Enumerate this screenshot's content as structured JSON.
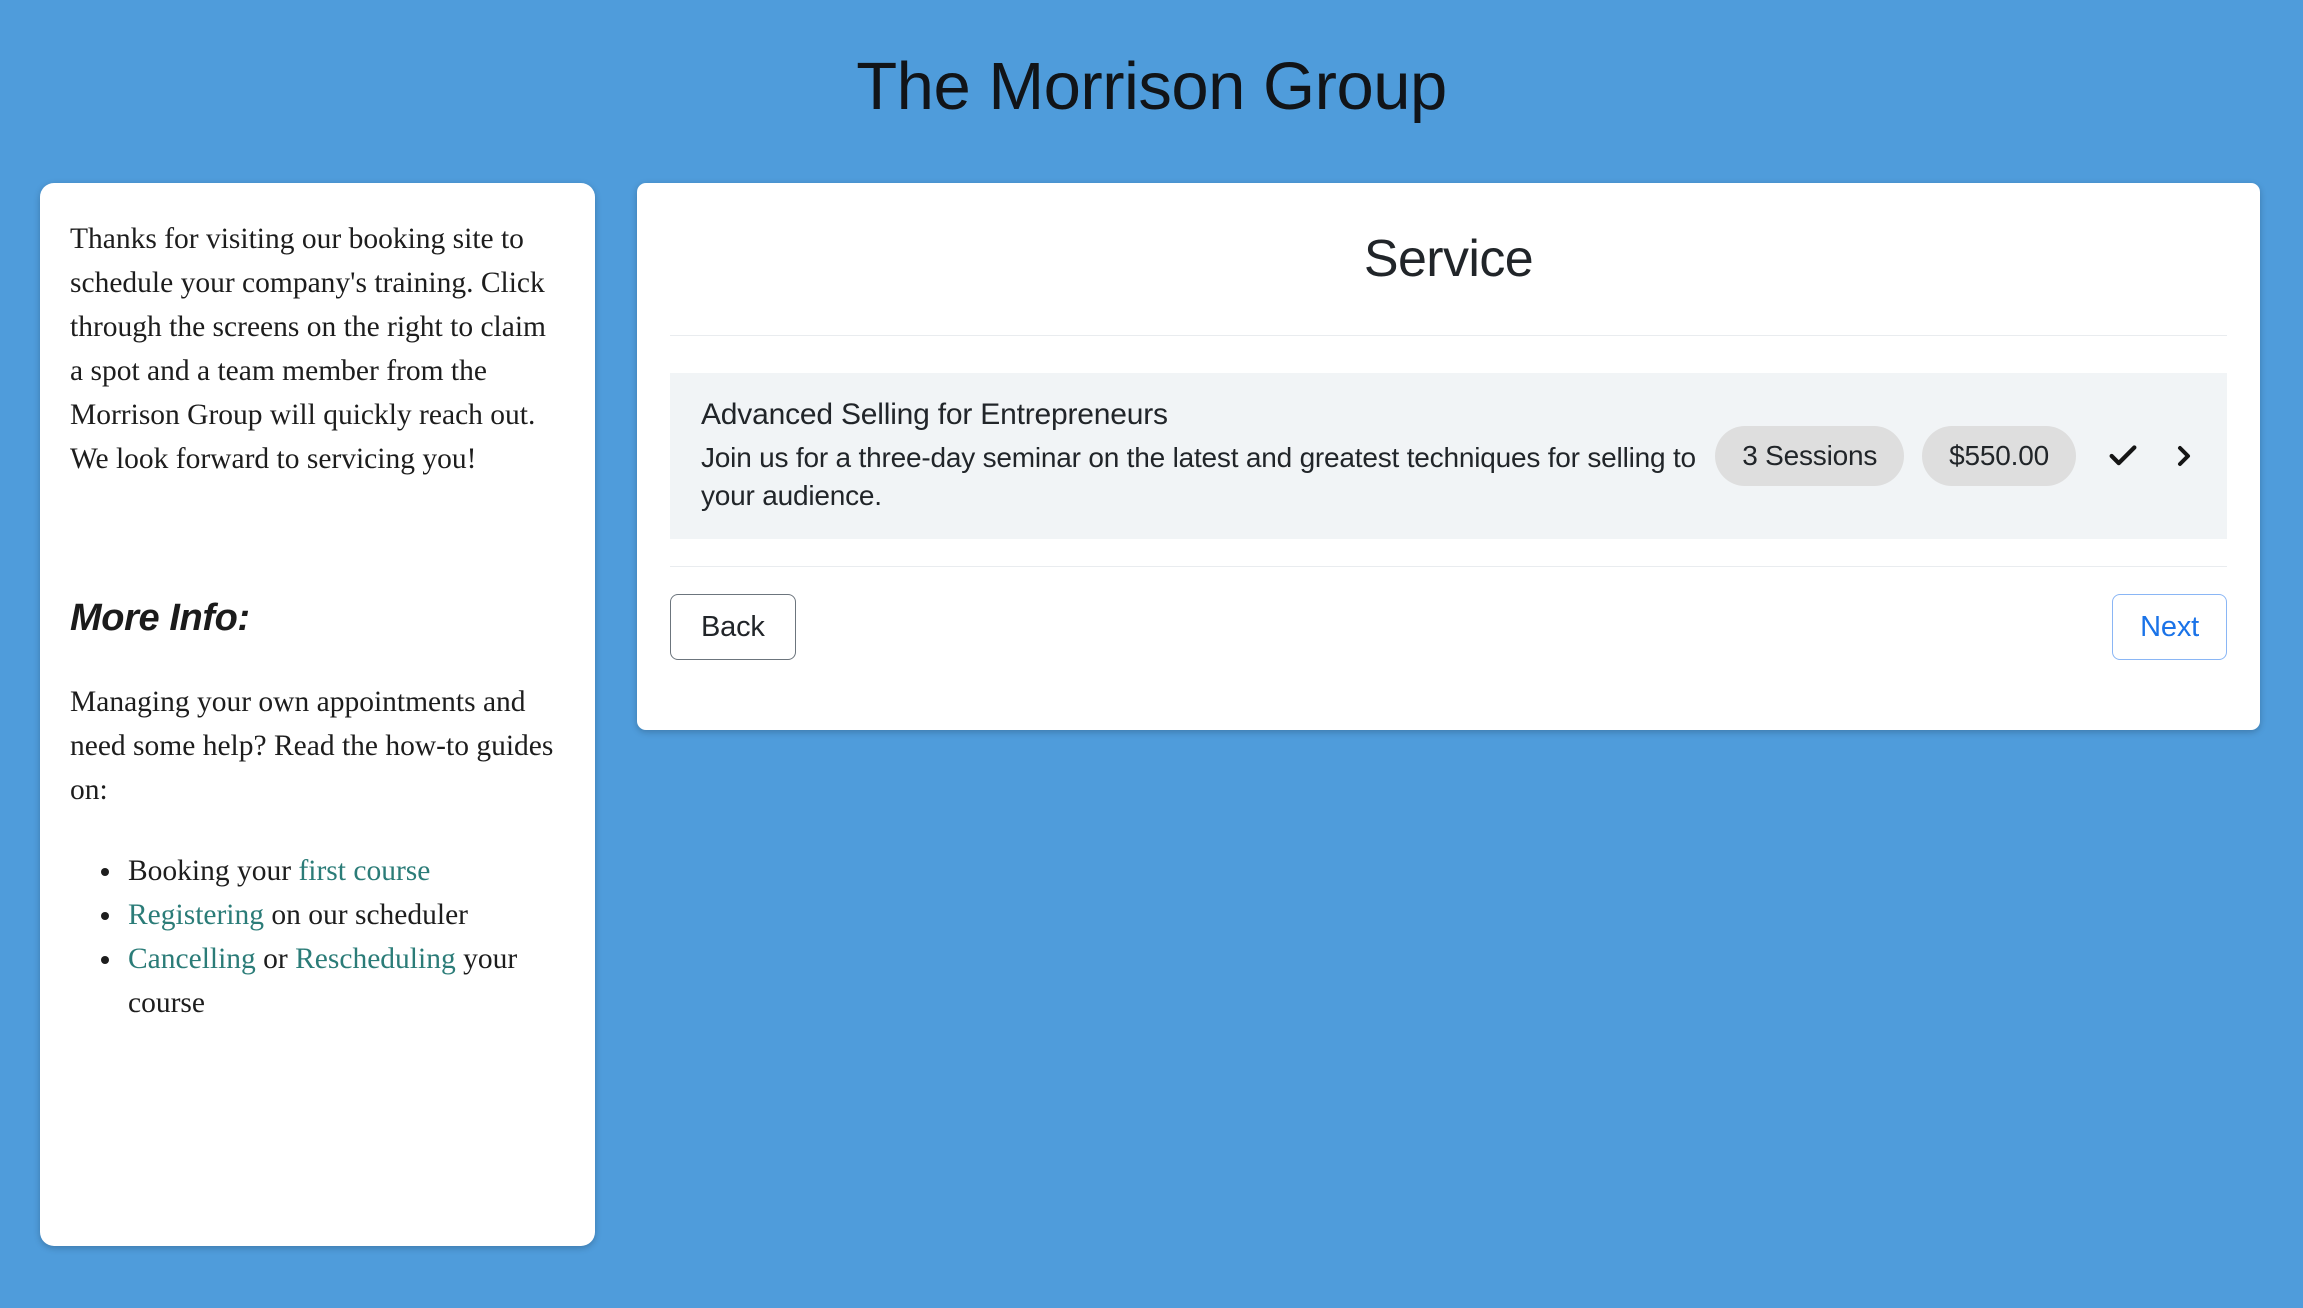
{
  "header": {
    "title": "The Morrison Group"
  },
  "background_color": "#4f9cdb",
  "accent_colors": {
    "link_teal": "#2b7c78",
    "next_blue": "#1a73e8",
    "row_background": "#f1f4f6",
    "badge_background": "#dedede"
  },
  "info_panel": {
    "intro": "Thanks for visiting our booking site to schedule your company's training. Click through the screens on the right to claim a spot and a team member from the Morrison Group will quickly reach out. We look forward to servicing you!",
    "more_info_heading": "More Info:",
    "more_info_sub": "Managing your own appointments and need some help? Read the how-to guides on:",
    "list": [
      {
        "prefix": "Booking your ",
        "link1": "first course",
        "middle": "",
        "link2": "",
        "suffix": ""
      },
      {
        "prefix": "",
        "link1": "Registering",
        "middle": " on our scheduler",
        "link2": "",
        "suffix": ""
      },
      {
        "prefix": "",
        "link1": "Cancelling",
        "middle": " or ",
        "link2": "Rescheduling",
        "suffix": " your course"
      }
    ]
  },
  "booking_panel": {
    "title": "Service",
    "services": [
      {
        "name": "Advanced Selling for Entrepreneurs",
        "description": "Join us for a three-day seminar on the latest and greatest techniques for selling to your audience.",
        "sessions_badge": "3 Sessions",
        "price_badge": "$550.00",
        "selected_icon": "check-icon",
        "expand_icon": "chevron-right-icon"
      }
    ],
    "back_label": "Back",
    "next_label": "Next"
  }
}
